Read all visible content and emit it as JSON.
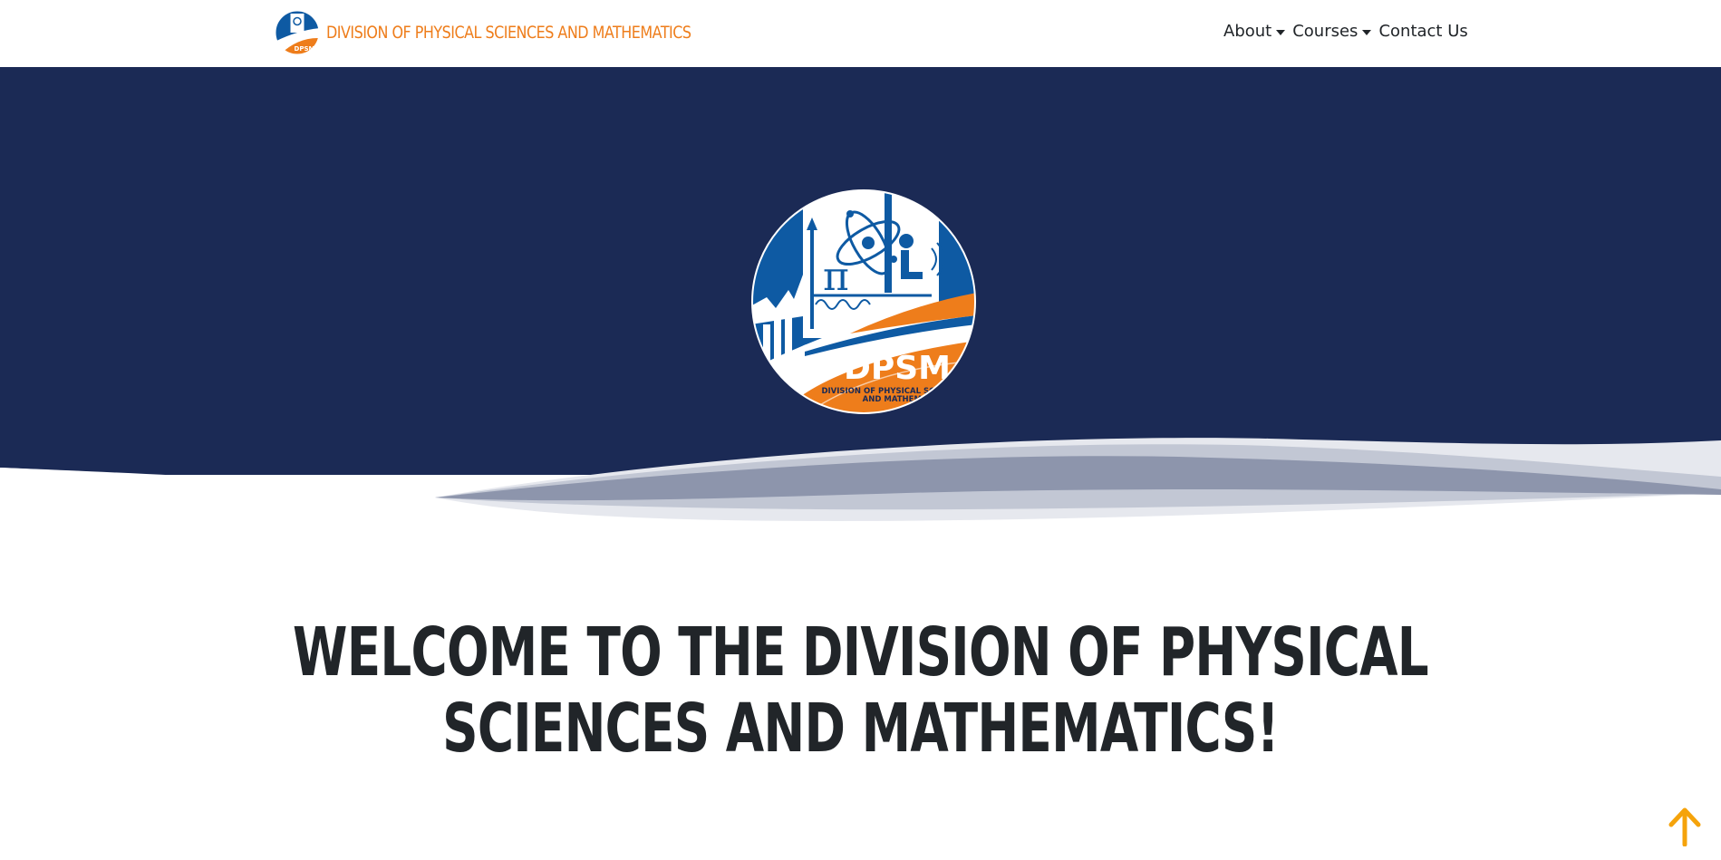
{
  "navbar": {
    "brand_text": "DIVISION OF PHYSICAL SCIENCES AND MATHEMATICS",
    "logo_icon": "dpsm-logo-icon",
    "items": [
      {
        "label": "About",
        "dropdown": true
      },
      {
        "label": "Courses",
        "dropdown": true
      },
      {
        "label": "Contact Us",
        "dropdown": false
      }
    ]
  },
  "hero": {
    "logo_text": "DPSM",
    "logo_subtitle_line1": "DIVISION OF PHYSICAL SCIENCES",
    "logo_subtitle_line2": "AND MATHEMATICS",
    "background_color": "#1b2a55"
  },
  "main": {
    "heading_line1": "WELCOME TO THE DIVISION OF PHYSICAL",
    "heading_line2": "SCIENCES AND MATHEMATICS!"
  },
  "back_to_top": {
    "icon": "arrow-up-icon",
    "color": "#f5a30b"
  },
  "colors": {
    "accent": "#ee7d1b",
    "navy": "#1b2a55",
    "logo_blue": "#0e5aa3",
    "logo_orange": "#ee7d1b"
  }
}
